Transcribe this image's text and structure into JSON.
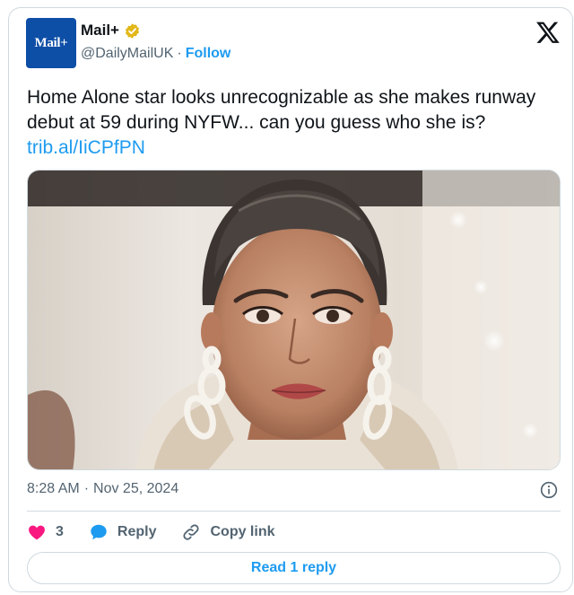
{
  "account": {
    "avatar_text": "Mail+",
    "name": "Mail+",
    "handle": "@DailyMailUK",
    "separator": "·",
    "follow_label": "Follow"
  },
  "tweet": {
    "text": "Home Alone star looks unrecognizable as she makes runway debut at 59 during NYFW... can you guess who she is? ",
    "link": "trib.al/IiCPfPN"
  },
  "meta": {
    "time": "8:28 AM",
    "separator": "·",
    "date": "Nov 25, 2024"
  },
  "actions": {
    "like_count": "3",
    "reply_label": "Reply",
    "copy_link_label": "Copy link"
  },
  "footer": {
    "read_reply_label": "Read 1 reply"
  },
  "colors": {
    "accent": "#1d9bf0",
    "like": "#f91880",
    "muted": "#536471",
    "border": "#cfd9de",
    "brand": "#0d4ea6",
    "verified_gold": "#e2b719"
  },
  "icons": {
    "verified": "verified-badge-icon",
    "logo": "x-logo-icon",
    "info": "info-icon",
    "like": "heart-icon",
    "reply": "speech-bubble-icon",
    "copy": "link-icon"
  }
}
